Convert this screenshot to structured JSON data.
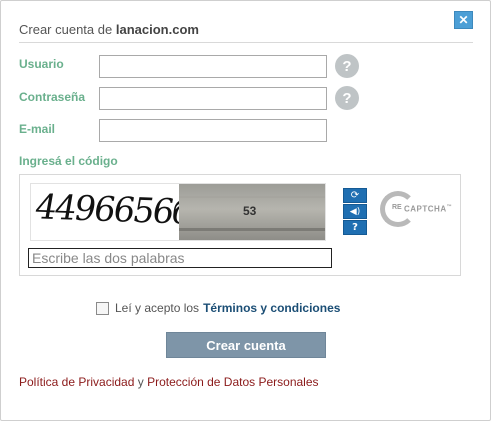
{
  "dialog": {
    "title_prefix": "Crear cuenta de",
    "title_brand": "lanacion.com",
    "close_label": "✕"
  },
  "form": {
    "username_label": "Usuario",
    "password_label": "Contraseña",
    "email_label": "E-mail",
    "code_label": "Ingresá el código",
    "username_value": "",
    "password_value": "",
    "email_value": "",
    "help_symbol": "?"
  },
  "captcha": {
    "word1": "4496656б",
    "word2": "53",
    "refresh_symbol": "⟳",
    "audio_symbol": "🔈",
    "help_symbol": "?",
    "logo_re": "RE",
    "logo_word": "CAPTCHA",
    "logo_tm": "™",
    "response_placeholder": "Escribe las dos palabras",
    "response_value": ""
  },
  "terms": {
    "text": "Leí y acepto los",
    "link_label": "Términos y condiciones",
    "checked": false
  },
  "submit": {
    "label": "Crear cuenta"
  },
  "footer": {
    "privacy_link": "Política de Privacidad",
    "connector": "y",
    "data_link": "Protección de Datos Personales"
  },
  "colors": {
    "label_green": "#6ab08d",
    "close_blue": "#4c9fd6",
    "button_gray_blue": "#7e95a8",
    "terms_link": "#1b4e75",
    "footer_link": "#8b1a1a"
  }
}
